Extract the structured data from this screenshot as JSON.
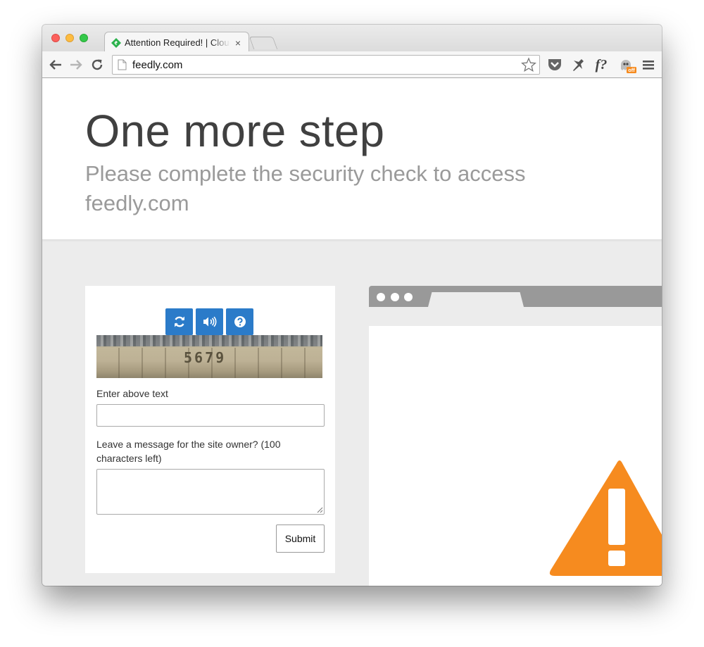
{
  "browser": {
    "tab": {
      "title": "Attention Required! | Cloudflare",
      "close_glyph": "×"
    },
    "url": "feedly.com",
    "colors": {
      "close": "#fc605c",
      "minimize": "#fdbc40",
      "maximize": "#34c84a"
    }
  },
  "extensions": {
    "f_label": "f?",
    "badge_label": "off"
  },
  "hero": {
    "title": "One more step",
    "subtitle": "Please complete the security check to access feedly.com"
  },
  "captcha": {
    "buttons": [
      "refresh-icon",
      "audio-icon",
      "help-icon"
    ],
    "image_text": "5679",
    "answer_label": "Enter above text",
    "answer_value": "",
    "message_label": "Leave a message for the site owner? (100 characters left)",
    "message_value": "",
    "submit_label": "Submit",
    "accent": "#2b7bc9"
  },
  "illustration": {
    "warning_color": "#f68b1f"
  }
}
